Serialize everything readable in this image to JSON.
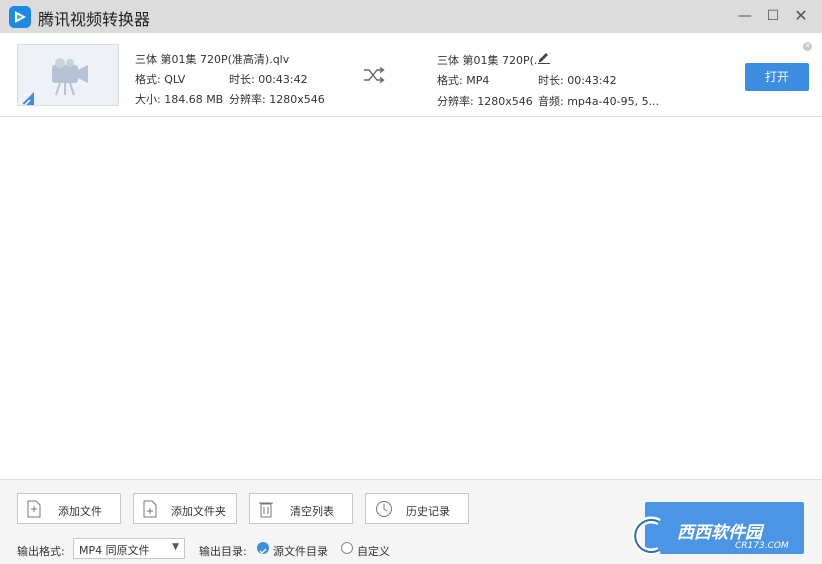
{
  "window": {
    "title": "腾讯视频转换器",
    "minimize_icon": "minimize-icon",
    "maximize_icon": "maximize-icon",
    "close_icon": "close-icon",
    "minimize_glyph": "—",
    "maximize_glyph": "☐",
    "close_glyph": "✕"
  },
  "file_item": {
    "source": {
      "name": "三体 第01集 720P(准高清).qlv",
      "format": "格式: QLV",
      "duration": "时长: 00:43:42",
      "size": "大小: 184.68 MB",
      "resolution": "分辨率: 1280x546"
    },
    "output": {
      "name": "三体 第01集 720P(...",
      "format": "格式: MP4",
      "duration": "时长: 00:43:42",
      "resolution": "分辨率: 1280x546",
      "audio": "音频: mp4a-40-95, 5..."
    },
    "open_label": "打开",
    "remove_glyph": "✕"
  },
  "toolbar": {
    "add_file_label": "添加文件",
    "add_folder_label": "添加文件夹",
    "clear_list_label": "清空列表",
    "history_label": "历史记录"
  },
  "output_settings": {
    "format_label": "输出格式:",
    "format_value": "MP4 同原文件",
    "dir_label": "输出目录:",
    "dir_option_source": "源文件目录",
    "dir_option_custom": "自定义",
    "selected_dir_option": "源文件目录"
  },
  "watermark": {
    "text": "西西软件园",
    "sub": "CR173.COM"
  },
  "colors": {
    "accent": "#3d8ee0",
    "titlebar": "#dcdcdc"
  }
}
